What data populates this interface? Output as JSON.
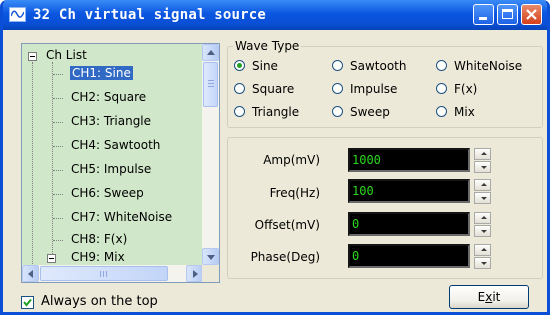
{
  "window": {
    "title": "32 Ch virtual signal source",
    "icon": "waveform-icon",
    "controls": [
      "minimize",
      "maximize",
      "close"
    ],
    "accent_color": "#0a4fd6"
  },
  "channel_tree": {
    "root_label": "Ch List",
    "selected": "CH1: Sine",
    "items": [
      "CH1: Sine",
      "CH2: Square",
      "CH3: Triangle",
      "CH4: Sawtooth",
      "CH5: Impulse",
      "CH6: Sweep",
      "CH7: WhiteNoise",
      "CH8: F(x)",
      "CH9: Mix"
    ],
    "background_color": "#d1e7c9",
    "selection_color": "#316ac5"
  },
  "wave_type": {
    "title": "Wave Type",
    "selected": "Sine",
    "options": [
      [
        "Sine",
        "Sawtooth",
        "WhiteNoise"
      ],
      [
        "Square",
        "Impulse",
        "F(x)"
      ],
      [
        "Triangle",
        "Sweep",
        "Mix"
      ]
    ]
  },
  "params": [
    {
      "label": "Amp(mV)",
      "value": "1000"
    },
    {
      "label": "Freq(Hz)",
      "value": "100"
    },
    {
      "label": "Offset(mV)",
      "value": "0"
    },
    {
      "label": "Phase(Deg)",
      "value": "0"
    }
  ],
  "param_value_color": "#2cd61f",
  "always_on_top": {
    "label": "Always on the top",
    "checked": true
  },
  "exit_button": {
    "label": "Exit",
    "accelerator": "x"
  }
}
